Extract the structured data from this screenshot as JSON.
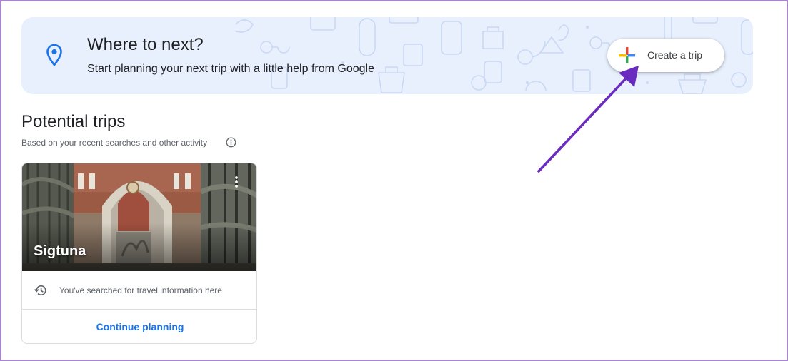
{
  "banner": {
    "title": "Where to next?",
    "subtitle": "Start planning your next trip with a little help from Google",
    "create_button_label": "Create a trip",
    "icons": [
      "location-pin-icon",
      "colorful-plus-icon"
    ]
  },
  "section": {
    "title": "Potential trips",
    "subtitle": "Based on your recent searches and other activity",
    "info_icon": "info-icon"
  },
  "trip_card": {
    "title": "Sigtuna",
    "history_text": "You've searched for travel information here",
    "action_label": "Continue planning",
    "icons": [
      "history-icon",
      "more-vert-icon"
    ]
  },
  "colors": {
    "banner_bg": "#e8f0fe",
    "link_blue": "#1a73e8",
    "annotation_arrow": "#6a2bbf",
    "frame_border": "#a887c9"
  }
}
